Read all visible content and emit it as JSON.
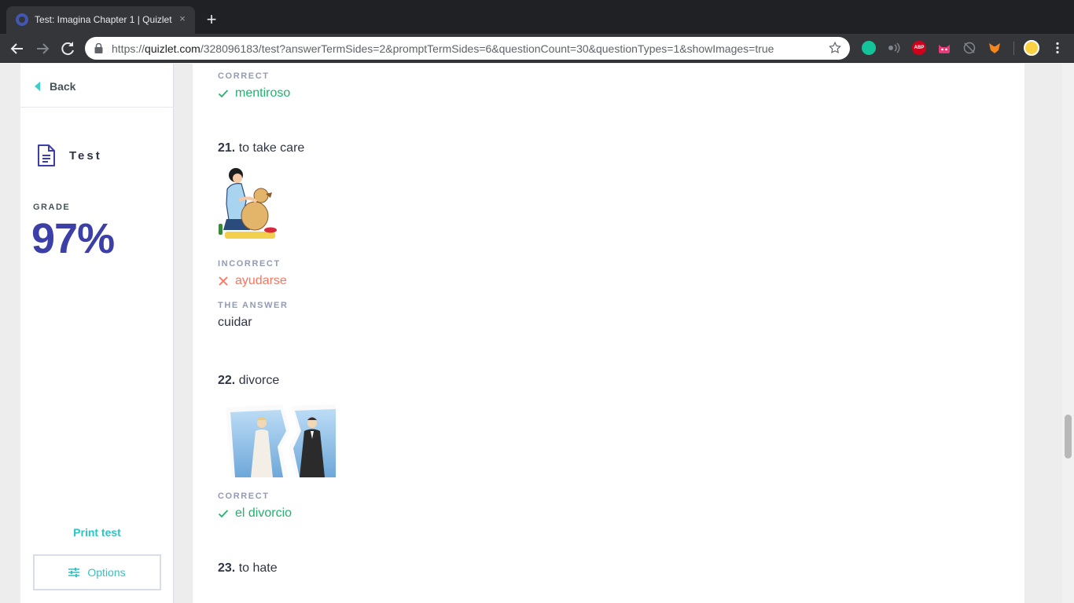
{
  "browser": {
    "tab_title": "Test: Imagina Chapter 1 | Quizlet",
    "tab_close": "×",
    "new_tab": "+",
    "url_scheme": "https://",
    "url_host": "quizlet.com",
    "url_path": "/328096183/test?answerTermSides=2&promptTermSides=6&questionCount=30&questionTypes=1&showImages=true",
    "extensions": [
      "grammarly-icon",
      "audio-icon",
      "adblock-plus-icon",
      "cat-extension-icon",
      "sleep-icon",
      "metamask-fox-icon",
      "profile-avatar-icon"
    ],
    "ext_abp_text": "ABP"
  },
  "sidebar": {
    "back_label": "Back",
    "mode_label": "Test",
    "grade_label": "GRADE",
    "grade_value": "97%",
    "print_label": "Print test",
    "options_label": "Options"
  },
  "questions": [
    {
      "status_label": "CORRECT",
      "status": "correct",
      "answer": "mentiroso"
    },
    {
      "number": "21.",
      "prompt": "to take care",
      "image": "woman-grooming-dog-clipart",
      "status_label": "INCORRECT",
      "status": "incorrect",
      "answer": "ayudarse",
      "correct_label": "THE ANSWER",
      "correct_answer": "cuidar"
    },
    {
      "number": "22.",
      "prompt": "divorce",
      "image": "torn-wedding-photo",
      "status_label": "CORRECT",
      "status": "correct",
      "answer": "el divorcio"
    },
    {
      "number": "23.",
      "prompt": "to hate"
    }
  ],
  "colors": {
    "accent": "#2ec4c4",
    "grade": "#3c3fa8",
    "correct": "#23b26d",
    "incorrect": "#ff725b",
    "label": "#939bb4"
  }
}
